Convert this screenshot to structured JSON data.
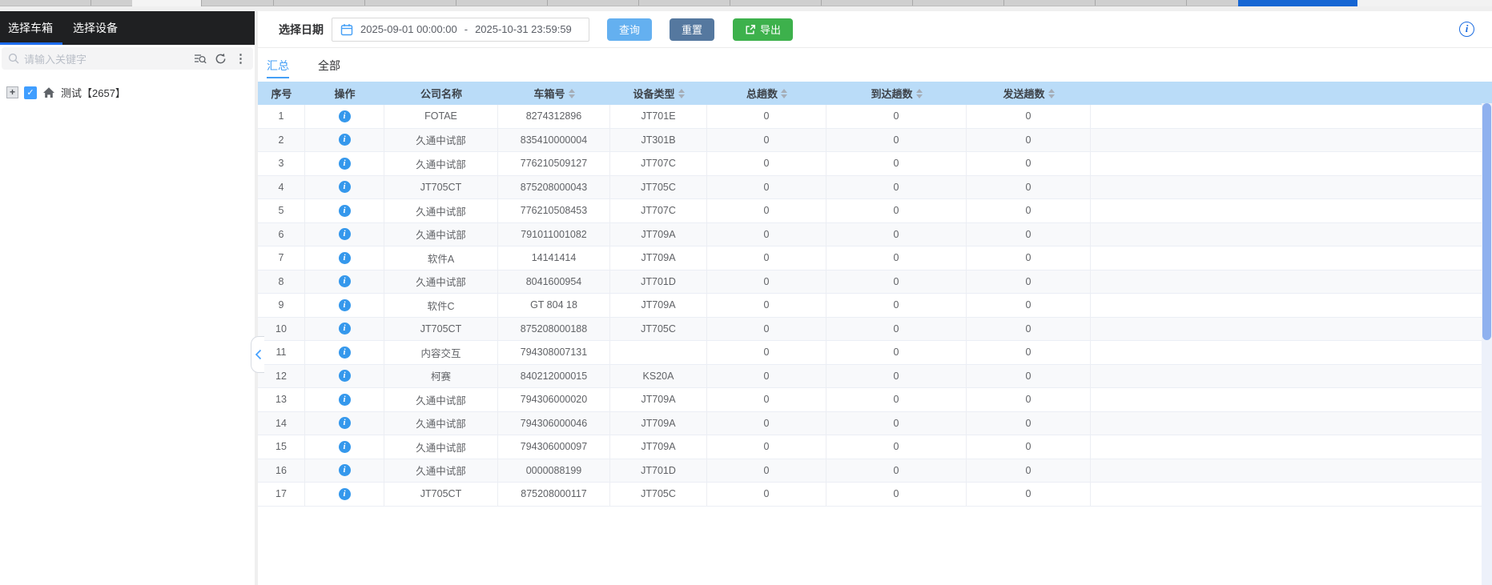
{
  "sidebar": {
    "tabs": [
      {
        "label": "选择车箱",
        "active": true
      },
      {
        "label": "选择设备",
        "active": false
      }
    ],
    "search": {
      "placeholder": "请输入关键字"
    },
    "tree": {
      "root_label": "测试【2657】",
      "checked": true
    }
  },
  "toolbar": {
    "date_label": "选择日期",
    "date_start": "2025-09-01 00:00:00",
    "date_separator": "-",
    "date_end": "2025-10-31 23:59:59",
    "query_label": "查询",
    "reset_label": "重置",
    "export_label": "导出"
  },
  "main": {
    "tabs": [
      {
        "label": "汇总",
        "active": true
      },
      {
        "label": "全部",
        "active": false
      }
    ]
  },
  "table": {
    "columns": [
      {
        "label": "序号",
        "sortable": false
      },
      {
        "label": "操作",
        "sortable": false
      },
      {
        "label": "公司名称",
        "sortable": false
      },
      {
        "label": "车箱号",
        "sortable": true
      },
      {
        "label": "设备类型",
        "sortable": true
      },
      {
        "label": "总趟数",
        "sortable": true
      },
      {
        "label": "到达趟数",
        "sortable": true
      },
      {
        "label": "发送趟数",
        "sortable": true
      }
    ],
    "rows": [
      {
        "no": 1,
        "company": "FOTAE",
        "box": "8274312896",
        "type": "JT701E",
        "total": 0,
        "arrived": 0,
        "sent": 0
      },
      {
        "no": 2,
        "company": "久通中试部",
        "box": "835410000004",
        "type": "JT301B",
        "total": 0,
        "arrived": 0,
        "sent": 0
      },
      {
        "no": 3,
        "company": "久通中试部",
        "box": "776210509127",
        "type": "JT707C",
        "total": 0,
        "arrived": 0,
        "sent": 0
      },
      {
        "no": 4,
        "company": "JT705CT",
        "box": "875208000043",
        "type": "JT705C",
        "total": 0,
        "arrived": 0,
        "sent": 0
      },
      {
        "no": 5,
        "company": "久通中试部",
        "box": "776210508453",
        "type": "JT707C",
        "total": 0,
        "arrived": 0,
        "sent": 0
      },
      {
        "no": 6,
        "company": "久通中试部",
        "box": "791011001082",
        "type": "JT709A",
        "total": 0,
        "arrived": 0,
        "sent": 0
      },
      {
        "no": 7,
        "company": "软件A",
        "box": "14141414",
        "type": "JT709A",
        "total": 0,
        "arrived": 0,
        "sent": 0
      },
      {
        "no": 8,
        "company": "久通中试部",
        "box": "8041600954",
        "type": "JT701D",
        "total": 0,
        "arrived": 0,
        "sent": 0
      },
      {
        "no": 9,
        "company": "软件C",
        "box": "GT 804 18",
        "type": "JT709A",
        "total": 0,
        "arrived": 0,
        "sent": 0
      },
      {
        "no": 10,
        "company": "JT705CT",
        "box": "875208000188",
        "type": "JT705C",
        "total": 0,
        "arrived": 0,
        "sent": 0
      },
      {
        "no": 11,
        "company": "内容交互",
        "box": "794308007131",
        "type": "",
        "total": 0,
        "arrived": 0,
        "sent": 0
      },
      {
        "no": 12,
        "company": "柯赛",
        "box": "840212000015",
        "type": "KS20A",
        "total": 0,
        "arrived": 0,
        "sent": 0
      },
      {
        "no": 13,
        "company": "久通中试部",
        "box": "794306000020",
        "type": "JT709A",
        "total": 0,
        "arrived": 0,
        "sent": 0
      },
      {
        "no": 14,
        "company": "久通中试部",
        "box": "794306000046",
        "type": "JT709A",
        "total": 0,
        "arrived": 0,
        "sent": 0
      },
      {
        "no": 15,
        "company": "久通中试部",
        "box": "794306000097",
        "type": "JT709A",
        "total": 0,
        "arrived": 0,
        "sent": 0
      },
      {
        "no": 16,
        "company": "久通中试部",
        "box": "0000088199",
        "type": "JT701D",
        "total": 0,
        "arrived": 0,
        "sent": 0
      },
      {
        "no": 17,
        "company": "JT705CT",
        "box": "875208000117",
        "type": "JT705C",
        "total": 0,
        "arrived": 0,
        "sent": 0
      }
    ]
  },
  "colors": {
    "query_button": "#64b0f0",
    "reset_button": "#55789f",
    "export_button": "#3db14c",
    "table_header_bg": "#badcf8",
    "active_tab_blue": "#459ff6",
    "sidebar_header_bg": "#1f2022",
    "sidebar_tab_underline": "#1d6ced",
    "info_icon_blue": "#3598ec",
    "scrollbar_thumb": "#8fb1ef",
    "top_strip_blue": "#1666d3"
  }
}
